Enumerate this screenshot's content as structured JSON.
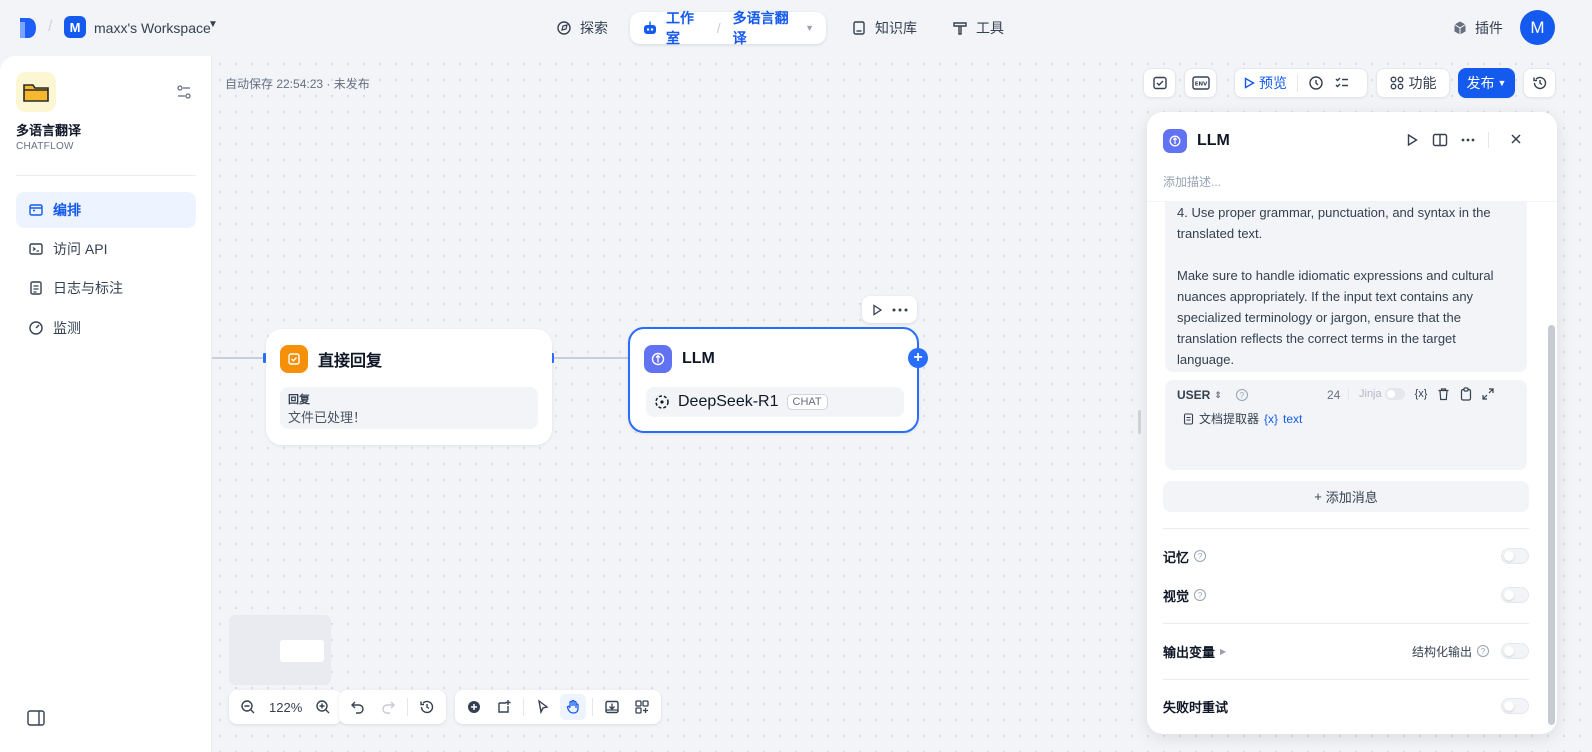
{
  "topbar": {
    "workspace_initial": "M",
    "workspace_name": "maxx's Workspace",
    "nav": {
      "explore": "探索",
      "studio": "工作室",
      "current_app": "多语言翻译",
      "knowledge": "知识库",
      "tools": "工具"
    },
    "plugins": "插件",
    "user_initial": "M"
  },
  "sidebar": {
    "app_name": "多语言翻译",
    "app_mode": "CHATFLOW",
    "items": [
      {
        "label": "编排",
        "icon": "orchestrate-icon",
        "active": true
      },
      {
        "label": "访问 API",
        "icon": "terminal-icon",
        "active": false
      },
      {
        "label": "日志与标注",
        "icon": "document-icon",
        "active": false
      },
      {
        "label": "监测",
        "icon": "gauge-icon",
        "active": false
      }
    ]
  },
  "canvas": {
    "autosave": "自动保存 22:54:23 · 未发布",
    "toolbar": {
      "preview": "预览",
      "features": "功能",
      "publish": "发布"
    },
    "nodes": {
      "answer": {
        "title": "直接回复",
        "field_label": "回复",
        "field_value": "文件已处理！"
      },
      "llm": {
        "title": "LLM",
        "model": "DeepSeek-R1",
        "model_tag": "CHAT"
      }
    },
    "zoom": "122%"
  },
  "panel": {
    "title": "LLM",
    "description_placeholder": "添加描述...",
    "prompt_lines": [
      "4. Use proper grammar, punctuation, and syntax in the translated text.",
      "Make sure to handle idiomatic expressions and cultural nuances appropriately. If the input text contains any specialized terminology or jargon, ensure that the translation reflects the correct terms in the target language."
    ],
    "user_message": {
      "role": "USER",
      "token_count": "24",
      "jinja_label": "Jinja",
      "var_icon": "{x}",
      "source": "文档提取器",
      "variable": "text"
    },
    "add_message": "添加消息",
    "memory": "记忆",
    "vision": "视觉",
    "output_vars": "输出变量",
    "structured_output": "结构化输出",
    "retry_on_failure": "失败时重试"
  },
  "colors": {
    "accent": "#155aef",
    "canvas_bg": "#f2f4f7",
    "answer_node": "#f79009",
    "llm_node": "#6172f3"
  }
}
